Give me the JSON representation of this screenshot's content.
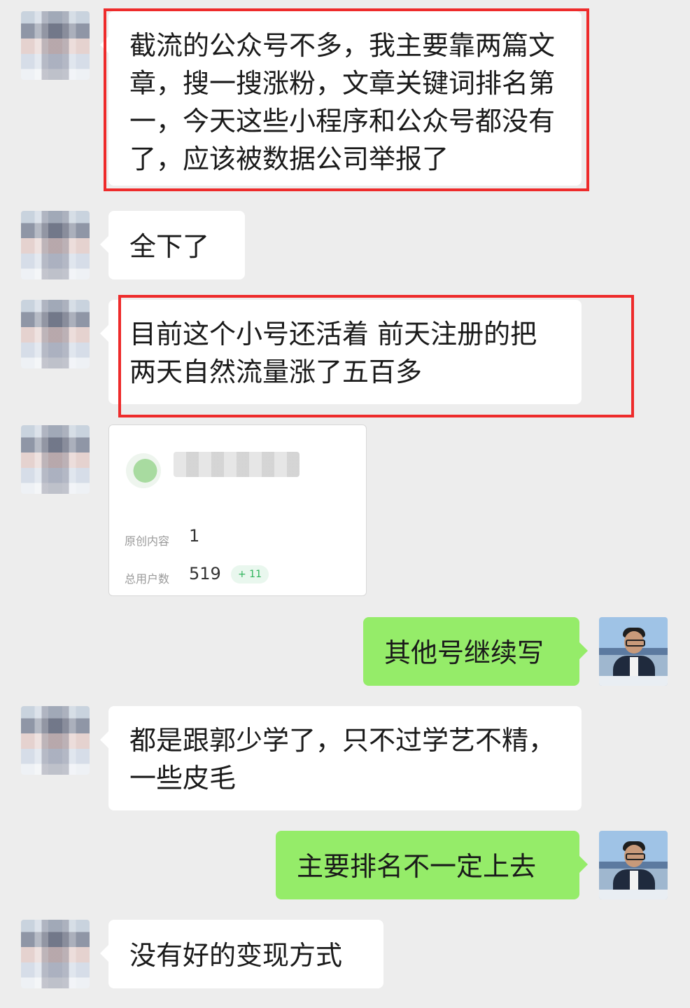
{
  "messages": [
    {
      "text": "截流的公众号不多，我主要靠两篇文章，搜一搜涨粉，文章关键词排名第一，今天这些小程序和公众号都没有了，应该被数据公司举报了"
    },
    {
      "text": "全下了"
    },
    {
      "text": "目前这个小号还活着 前天注册的把 两天自然流量涨了五百多"
    },
    {
      "text": "其他号继续写"
    },
    {
      "text": "都是跟郭少学了，只不过学艺不精，一些皮毛"
    },
    {
      "text": "主要排名不一定上去"
    },
    {
      "text": "没有好的变现方式"
    }
  ],
  "card": {
    "original_label": "原创内容",
    "original_value": "1",
    "users_label": "总用户数",
    "users_value": "519",
    "users_delta": "+ 11"
  },
  "colors": {
    "background": "#ededed",
    "incoming_bubble": "#ffffff",
    "outgoing_bubble": "#95ec69",
    "highlight_border": "#ee2b2b"
  }
}
